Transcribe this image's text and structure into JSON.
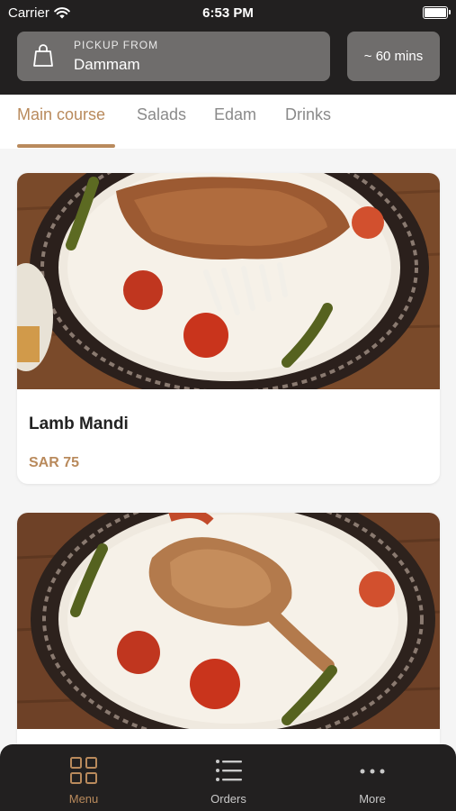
{
  "status_bar": {
    "carrier": "Carrier",
    "time": "6:53 PM"
  },
  "header": {
    "pickup_label": "PICKUP FROM",
    "pickup_city": "Dammam",
    "eta": "~ 60 mins"
  },
  "tabs": [
    {
      "label": "Main course",
      "active": true
    },
    {
      "label": "Salads"
    },
    {
      "label": "Edam"
    },
    {
      "label": "Drinks"
    }
  ],
  "dishes": [
    {
      "name": "Lamb Mandi",
      "price": "SAR 75",
      "image": "lamb-mandi-photo"
    },
    {
      "name": "",
      "price": "",
      "image": "chicken-mandi-photo"
    }
  ],
  "bottom_nav": [
    {
      "label": "Menu",
      "icon": "grid-icon",
      "active": true
    },
    {
      "label": "Orders",
      "icon": "list-icon"
    },
    {
      "label": "More",
      "icon": "more-icon"
    }
  ],
  "colors": {
    "accent": "#b98a5c",
    "header_bg": "#222020",
    "chip_bg": "#6f6d6c"
  }
}
